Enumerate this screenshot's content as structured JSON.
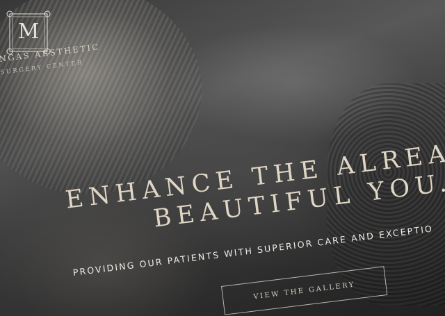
{
  "brand": {
    "logo_letter": "M",
    "name": "NGAS AESTHETIC",
    "subtitle": "SURGERY CENTER"
  },
  "hero": {
    "headline_line1": "ENHANCE THE ALREA",
    "headline_line2": "BEAUTIFUL YOU.",
    "subheadline": "PROVIDING OUR PATIENTS WITH SUPERIOR CARE AND EXCEPTIO",
    "cta_label": "VIEW THE GALLERY"
  },
  "colors": {
    "headline": "#e0d6c5",
    "overlay_text": "#f0ece6"
  }
}
